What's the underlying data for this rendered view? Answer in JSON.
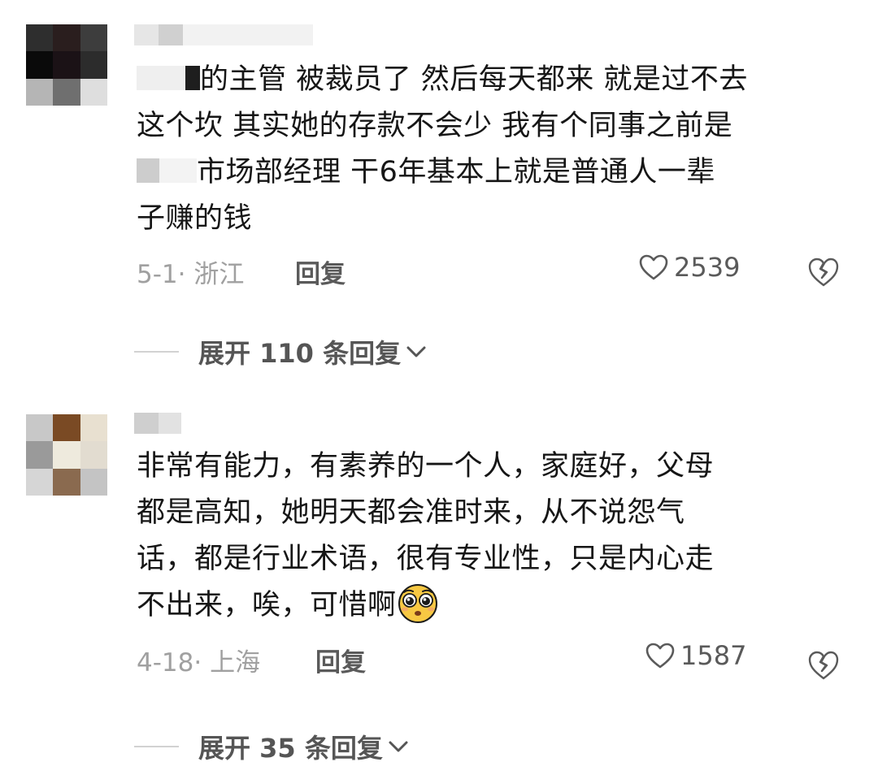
{
  "comments": [
    {
      "avatar_tiles": [
        "#2e2e2e",
        "#2a1e1e",
        "#3d3d3d",
        "#0a0a0a",
        "#1b1216",
        "#2c2c2c",
        "#b5b5b5",
        "#6f6f6f",
        "#dedede"
      ],
      "username_tiles": [
        "#e6e6e6",
        "#d0d0d0",
        "#f2f2f2"
      ],
      "text_lines": [
        "的主管 被裁员了 然后每天都来 就是过不去",
        "这个坎  其实她的存款不会少 我有个同事之前是",
        "市场部经理 干6年基本上就是普通人一辈",
        "子赚的钱"
      ],
      "date_location": "5-1· 浙江",
      "reply_label": "回复",
      "likes": "2539",
      "expand_label": "展开 110 条回复"
    },
    {
      "avatar_tiles": [
        "#c8c8c8",
        "#7a4a24",
        "#e8e0d0",
        "#9a9a9a",
        "#eeeadd",
        "#e2dcd0",
        "#d6d6d6",
        "#8a6a4f",
        "#c4c4c4"
      ],
      "username_tiles": [
        "#cfcfcf",
        "#e2e2e2"
      ],
      "text_lines": [
        "非常有能力，有素养的一个人，家庭好，父母",
        "都是高知，她明天都会准时来，从不说怨气",
        "话，都是行业术语，很有专业性，只是内心走",
        "不出来，唉，可惜啊"
      ],
      "emoji": "pleading-face",
      "date_location": "4-18· 上海",
      "reply_label": "回复",
      "likes": "1587",
      "expand_label": "展开 35 条回复"
    }
  ],
  "icons": {
    "like": "heart-outline-icon",
    "dislike": "broken-heart-outline-icon",
    "expand": "chevron-down-icon"
  },
  "colors": {
    "text": "#161616",
    "meta": "#a0a0a0",
    "action": "#5a5a5a"
  }
}
